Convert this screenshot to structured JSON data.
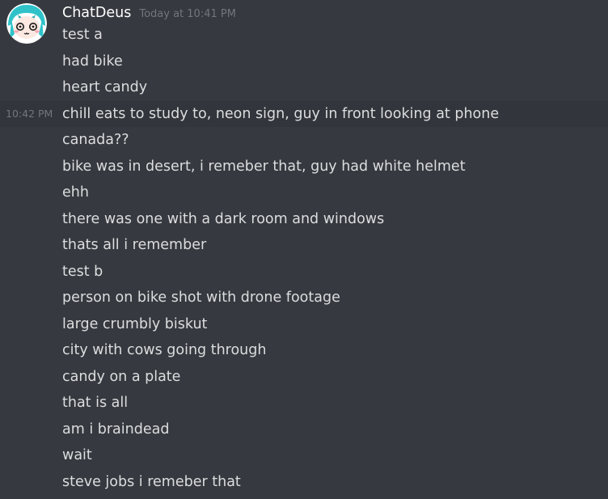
{
  "channel": {
    "author": {
      "username": "ChatDeus",
      "timestamp": "Today at 10:41 PM",
      "avatar_icon": "anime-girl-avatar"
    },
    "hover_timestamp": "10:42 PM",
    "highlighted_index": 3,
    "messages": [
      "test a",
      "had bike",
      "heart candy",
      "chill eats to study to, neon sign, guy in front looking at phone",
      "canada??",
      "bike was in desert, i remeber that, guy had white helmet",
      "ehh",
      "there was one with a dark room and windows",
      "thats all i remember",
      "test b",
      "person on bike shot with drone footage",
      "large crumbly biskut",
      "city with cows going through",
      "candy on a plate",
      "that is all",
      "am i braindead",
      "wait",
      "steve jobs i remeber that"
    ]
  },
  "colors": {
    "background": "#36393f",
    "highlight": "#32353b",
    "username": "#ffffff",
    "message_text": "#dcddde",
    "muted": "#72767d",
    "avatar_hair": "#2fc3c9"
  }
}
